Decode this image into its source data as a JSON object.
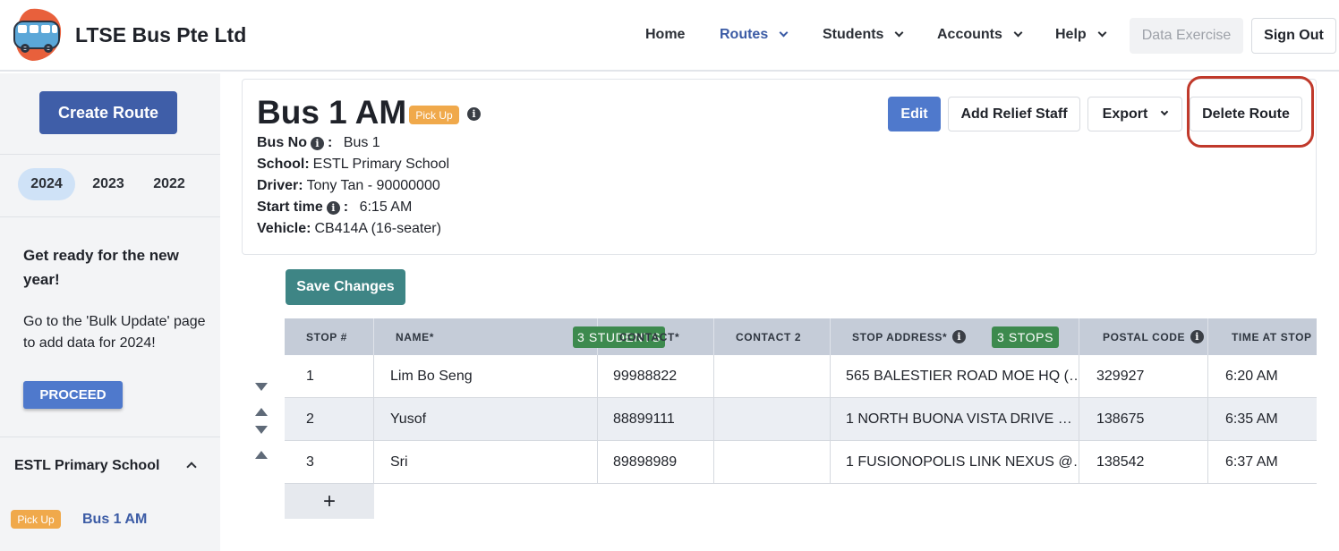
{
  "header": {
    "brand": "LTSE Bus Pte Ltd",
    "nav": {
      "home": "Home",
      "routes": "Routes",
      "students": "Students",
      "accounts": "Accounts",
      "help": "Help"
    },
    "data_exercise": "Data Exercise",
    "sign_out": "Sign Out"
  },
  "sidebar": {
    "create_route": "Create Route",
    "years": [
      "2024",
      "2023",
      "2022"
    ],
    "selected_year": "2024",
    "promo_heading": "Get ready for the new year!",
    "promo_text": "Go to the 'Bulk Update' page to add data for 2024!",
    "proceed": "PROCEED",
    "school": "ESTL Primary School",
    "route_pill": "Pick Up",
    "route_name": "Bus 1 AM"
  },
  "route": {
    "title": "Bus 1 AM",
    "type_pill": "Pick Up",
    "details": {
      "bus_no_label": "Bus No",
      "bus_no": "Bus 1",
      "school_label": "School:",
      "school": "ESTL Primary School",
      "driver_label": "Driver:",
      "driver": "Tony Tan - 90000000",
      "start_label": "Start time",
      "start": "6:15 AM",
      "vehicle_label": "Vehicle:",
      "vehicle": "CB414A (16-seater)"
    },
    "actions": {
      "edit": "Edit",
      "add_relief": "Add Relief Staff",
      "export": "Export",
      "delete": "Delete Route"
    }
  },
  "table": {
    "save_changes": "Save Changes",
    "columns": {
      "stop": "STOP #",
      "name": "NAME*",
      "contact": "CONTACT*",
      "contact2": "CONTACT 2",
      "address": "STOP ADDRESS*",
      "postal": "POSTAL CODE",
      "time": "TIME AT STOP"
    },
    "students_badge": "3 STUDENTS",
    "stops_badge": "3 STOPS",
    "rows": [
      {
        "stop": "1",
        "name": "Lim Bo Seng",
        "contact": "99988822",
        "contact2": "",
        "address": "565 BALESTIER ROAD MOE HQ (…",
        "postal": "329927",
        "time": "6:20 AM"
      },
      {
        "stop": "2",
        "name": "Yusof",
        "contact": "88899111",
        "contact2": "",
        "address": "1 NORTH BUONA VISTA DRIVE …",
        "postal": "138675",
        "time": "6:35 AM"
      },
      {
        "stop": "3",
        "name": "Sri",
        "contact": "89898989",
        "contact2": "",
        "address": "1 FUSIONOPOLIS LINK NEXUS @…",
        "postal": "138542",
        "time": "6:37 AM"
      }
    ],
    "add_row": "+"
  },
  "colors": {
    "primary": "#3f5ea8",
    "accent_blue": "#4f79cc",
    "save_teal": "#3e8585",
    "badge_green": "#3d8a4e",
    "pill_orange": "#f0a94b",
    "highlight_red": "#c0392b"
  },
  "icons": [
    "bus-logo-icon",
    "chevron-down-icon",
    "chevron-up-icon",
    "info-icon",
    "arrow-up-icon",
    "arrow-down-icon",
    "plus-icon"
  ]
}
